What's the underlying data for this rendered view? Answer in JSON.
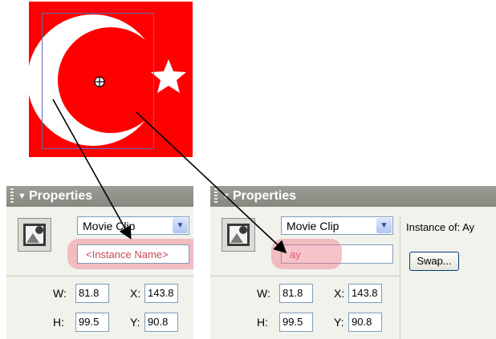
{
  "stage": {
    "flag_color": "#ff0000",
    "symbol_color": "#ffffff",
    "selection_color": "#5a6fb3"
  },
  "panel_left": {
    "title": "Properties",
    "symbol_type": "Movie Clip",
    "instance_placeholder": "<Instance Name>",
    "w_label": "W:",
    "w_value": "81.8",
    "x_label": "X:",
    "x_value": "143.8",
    "h_label": "H:",
    "h_value": "99.5",
    "y_label": "Y:",
    "y_value": "90.8"
  },
  "panel_right": {
    "title": "Properties",
    "symbol_type": "Movie Clip",
    "instance_name": "ay",
    "instance_of_label": "Instance of:",
    "instance_of_value": "Ay",
    "swap_label": "Swap...",
    "w_label": "W:",
    "w_value": "81.8",
    "x_label": "X:",
    "x_value": "143.8",
    "h_label": "H:",
    "h_value": "99.5",
    "y_label": "Y:",
    "y_value": "90.8"
  },
  "icons": [
    "movie-clip-icon",
    "dropdown-arrow-icon",
    "registration-point-icon",
    "panel-collapse-icon",
    "panel-gripper-icon"
  ],
  "accent_colors": {
    "title_bar": "#8f8f88",
    "highlight": "#f0788c",
    "field_border": "#7f9db9"
  }
}
